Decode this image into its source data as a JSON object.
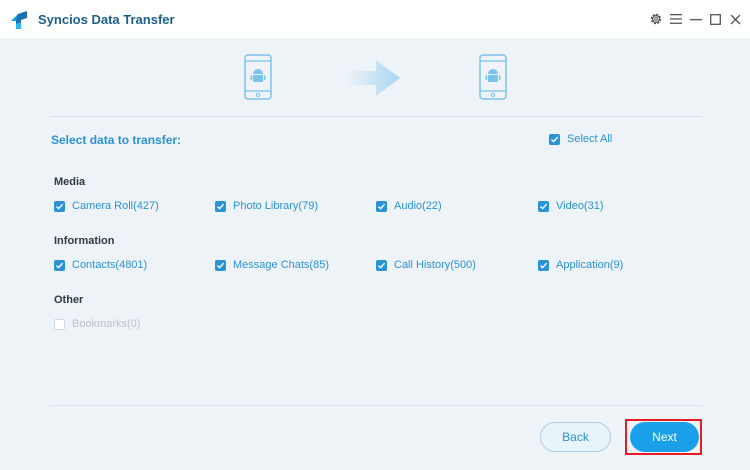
{
  "app": {
    "title": "Syncios Data Transfer",
    "brand_color": "#2a93d5"
  },
  "window_controls": [
    "gear-icon",
    "menu-icon",
    "minimize-icon",
    "maximize-icon",
    "close-icon"
  ],
  "transfer": {
    "source_device": "android-phone-icon",
    "target_device": "android-phone-icon"
  },
  "selection": {
    "title": "Select data to transfer:",
    "select_all_label": "Select All",
    "select_all_checked": true
  },
  "groups": {
    "media": {
      "label": "Media",
      "items": [
        {
          "label": "Camera Roll(427)",
          "checked": true
        },
        {
          "label": "Photo Library(79)",
          "checked": true
        },
        {
          "label": "Audio(22)",
          "checked": true
        },
        {
          "label": "Video(31)",
          "checked": true
        }
      ]
    },
    "information": {
      "label": "Information",
      "items": [
        {
          "label": "Contacts(4801)",
          "checked": true
        },
        {
          "label": "Message Chats(85)",
          "checked": true
        },
        {
          "label": "Call History(500)",
          "checked": true
        },
        {
          "label": "Application(9)",
          "checked": true
        }
      ]
    },
    "other": {
      "label": "Other",
      "items": [
        {
          "label": "Bookmarks(0)",
          "checked": false,
          "disabled": true
        }
      ]
    }
  },
  "footer": {
    "back_label": "Back",
    "next_label": "Next"
  }
}
